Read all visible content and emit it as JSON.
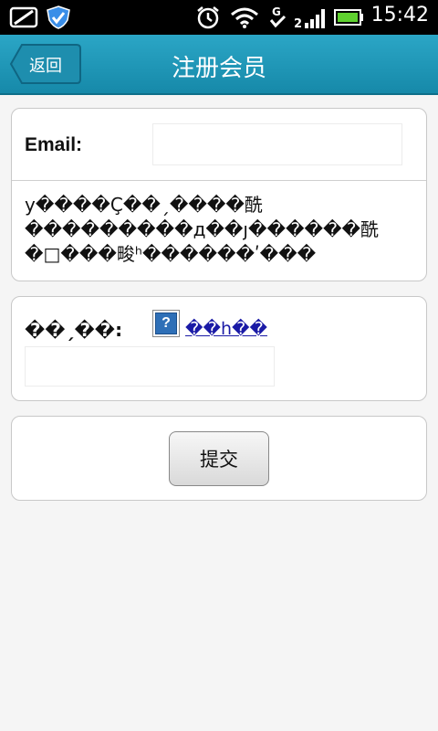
{
  "status_bar": {
    "time": "15:42",
    "icons": [
      "image-icon",
      "shield-icon",
      "alarm-icon",
      "wifi-icon",
      "g-data-icon",
      "signal-icon",
      "battery-icon"
    ],
    "data_label": "G"
  },
  "header": {
    "back_label": "返回",
    "title": "注册会员",
    "accent_color": "#1f99ba"
  },
  "form": {
    "email_label": "Email:",
    "email_value": "",
    "notice_text": "у����Ç��ˏ����酰\n���������д��ȷ������酰\n�□���畯ʰ������ʹ���",
    "captcha_label": "��ˏ��:",
    "captcha_icon": "broken-image-icon",
    "captcha_icon_glyph": "?",
    "refresh_link": "��һ��",
    "captcha_value": "",
    "submit_label": "提交"
  }
}
